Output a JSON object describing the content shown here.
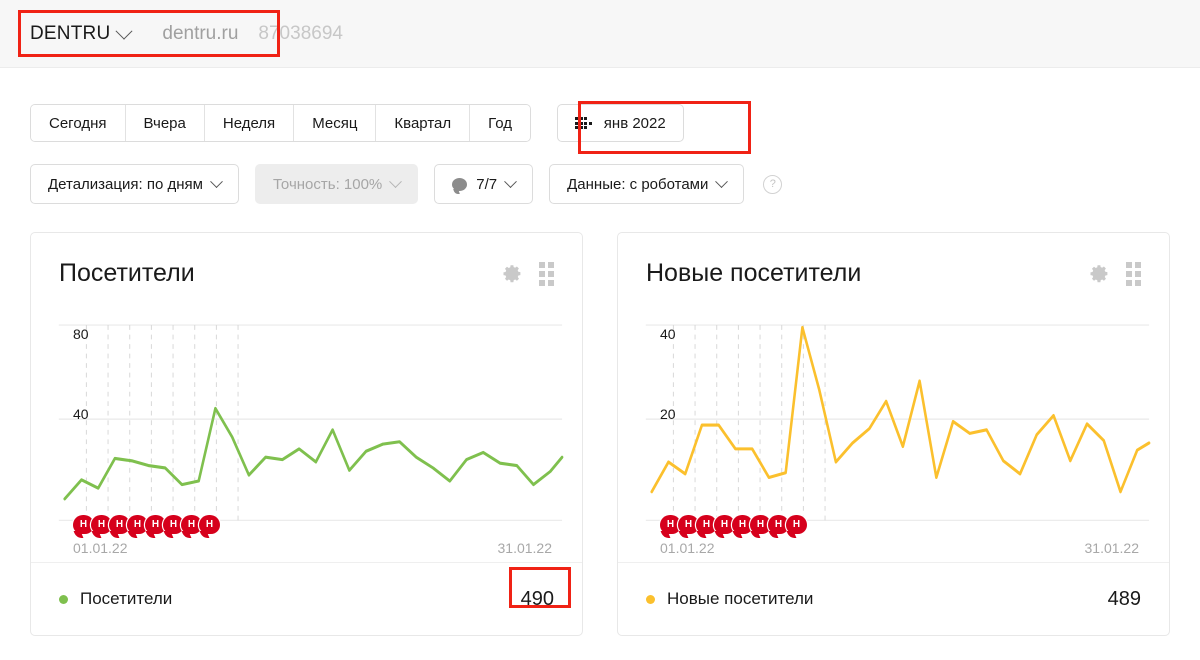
{
  "header": {
    "site_name": "DENTRU",
    "domain": "dentru.ru",
    "counter_id": "87038694"
  },
  "periods": {
    "items": [
      {
        "label": "Сегодня"
      },
      {
        "label": "Вчера"
      },
      {
        "label": "Неделя"
      },
      {
        "label": "Месяц"
      },
      {
        "label": "Квартал"
      },
      {
        "label": "Год"
      }
    ],
    "month_button": {
      "label": "янв 2022",
      "icon": "calendar-grid-icon"
    }
  },
  "filters": {
    "detail": "Детализация: по дням",
    "accuracy": "Точность: 100%",
    "goals": "7/7",
    "goals_icon": "speech-bubble-icon",
    "data": "Данные: с роботами",
    "help_icon": "question-mark-icon",
    "help_glyph": "?"
  },
  "colors": {
    "visitors_line": "#7fc04e",
    "new_visitors_line": "#fbc02d",
    "annotation": "#f02215",
    "holiday_badge": "#d6001c"
  },
  "holidays": {
    "letter": "Н",
    "count": 8
  },
  "cards": [
    {
      "title": "Посетители",
      "gear_icon": "gear-icon",
      "grid_icon": "grid-dots-icon",
      "legend_name": "Посетители",
      "legend_value": "490",
      "date_start": "01.01.22",
      "date_end": "31.01.22"
    },
    {
      "title": "Новые посетители",
      "gear_icon": "gear-icon",
      "grid_icon": "grid-dots-icon",
      "legend_name": "Новые посетители",
      "legend_value": "489",
      "date_start": "01.01.22",
      "date_end": "31.01.22"
    }
  ],
  "chart_data": [
    {
      "type": "line",
      "title": "Посетители",
      "xlabel": "",
      "ylabel": "",
      "ylim": [
        0,
        90
      ],
      "yticks": [
        40,
        80
      ],
      "ytick_labels": [
        "40",
        "80"
      ],
      "grid": true,
      "legend": "bottom",
      "x": [
        "01.01.22",
        "02.01.22",
        "03.01.22",
        "04.01.22",
        "05.01.22",
        "06.01.22",
        "07.01.22",
        "08.01.22",
        "09.01.22",
        "10.01.22",
        "11.01.22",
        "12.01.22",
        "13.01.22",
        "14.01.22",
        "15.01.22",
        "16.01.22",
        "17.01.22",
        "18.01.22",
        "19.01.22",
        "20.01.22",
        "21.01.22",
        "22.01.22",
        "23.01.22",
        "24.01.22",
        "25.01.22",
        "26.01.22",
        "27.01.22",
        "28.01.22",
        "29.01.22",
        "30.01.22",
        "31.01.22"
      ],
      "x_start_label": "01.01.22",
      "x_end_label": "31.01.22",
      "series": [
        {
          "name": "Посетители",
          "color": "#7fc04e",
          "total": 490,
          "values": [
            8,
            15,
            12,
            23,
            22,
            20,
            19,
            11,
            13,
            45,
            30,
            16,
            24,
            23,
            28,
            22,
            35,
            19,
            27,
            30,
            31,
            24,
            19,
            14,
            23,
            26,
            21,
            20,
            12,
            18,
            25
          ]
        }
      ],
      "holiday_days": [
        "01.01.22",
        "02.01.22",
        "03.01.22",
        "04.01.22",
        "05.01.22",
        "06.01.22",
        "07.01.22",
        "08.01.22"
      ]
    },
    {
      "type": "line",
      "title": "Новые посетители",
      "xlabel": "",
      "ylabel": "",
      "ylim": [
        0,
        45
      ],
      "yticks": [
        20,
        40
      ],
      "ytick_labels": [
        "20",
        "40"
      ],
      "grid": true,
      "legend": "bottom",
      "x": [
        "01.01.22",
        "02.01.22",
        "03.01.22",
        "04.01.22",
        "05.01.22",
        "06.01.22",
        "07.01.22",
        "08.01.22",
        "09.01.22",
        "10.01.22",
        "11.01.22",
        "12.01.22",
        "13.01.22",
        "14.01.22",
        "15.01.22",
        "16.01.22",
        "17.01.22",
        "18.01.22",
        "19.01.22",
        "20.01.22",
        "21.01.22",
        "22.01.22",
        "23.01.22",
        "24.01.22",
        "25.01.22",
        "26.01.22",
        "27.01.22",
        "28.01.22",
        "29.01.22",
        "30.01.22",
        "31.01.22"
      ],
      "x_start_label": "01.01.22",
      "x_end_label": "31.01.22",
      "series": [
        {
          "name": "Новые посетители",
          "color": "#fbc02d",
          "total": 489,
          "values": [
            8,
            15,
            12,
            21,
            21,
            17,
            17,
            11,
            13,
            41,
            25,
            14,
            17,
            19,
            25,
            18,
            29,
            11,
            22,
            20,
            21,
            15,
            12,
            19,
            22,
            14,
            20,
            18,
            8,
            16,
            17
          ]
        }
      ],
      "holiday_days": [
        "01.01.22",
        "02.01.22",
        "03.01.22",
        "04.01.22",
        "05.01.22",
        "06.01.22",
        "07.01.22",
        "08.01.22"
      ]
    }
  ]
}
